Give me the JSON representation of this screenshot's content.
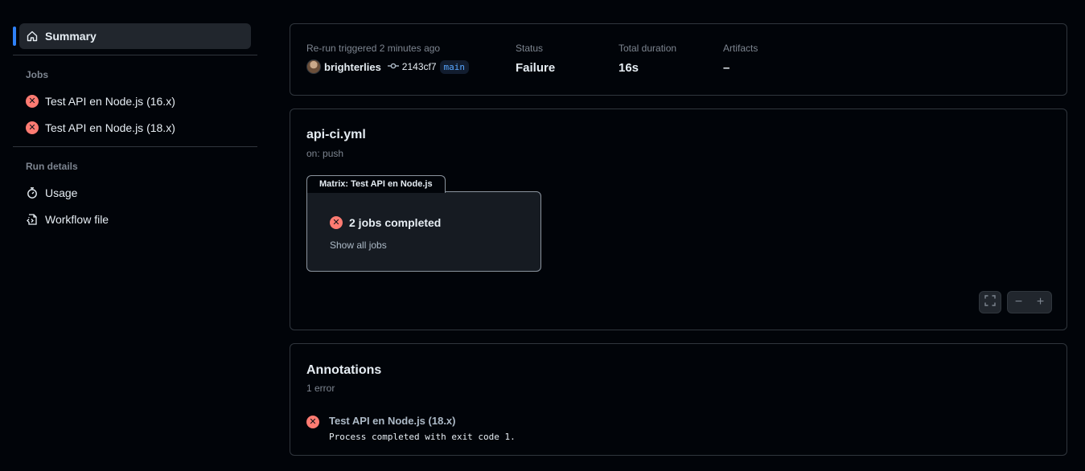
{
  "sidebar": {
    "summary_label": "Summary",
    "jobs_title": "Jobs",
    "jobs": [
      {
        "label": "Test API en Node.js (16.x)",
        "status": "failure"
      },
      {
        "label": "Test API en Node.js (18.x)",
        "status": "failure"
      }
    ],
    "run_details_title": "Run details",
    "usage_label": "Usage",
    "workflow_file_label": "Workflow file"
  },
  "summary": {
    "trigger_label": "Re-run triggered 2 minutes ago",
    "user": "brighterlies",
    "commit": "2143cf7",
    "branch": "main",
    "status_label": "Status",
    "status_value": "Failure",
    "duration_label": "Total duration",
    "duration_value": "16s",
    "artifacts_label": "Artifacts",
    "artifacts_value": "–"
  },
  "workflow": {
    "file": "api-ci.yml",
    "trigger": "on: push",
    "matrix_tab": "Matrix: Test API en Node.js",
    "matrix_status": "2 jobs completed",
    "show_all_jobs": "Show all jobs"
  },
  "annotations": {
    "title": "Annotations",
    "count_text": "1 error",
    "items": [
      {
        "job": "Test API en Node.js (18.x)",
        "message": "Process completed with exit code 1."
      }
    ]
  },
  "colors": {
    "background": "#010409",
    "failure": "#ff7b72",
    "accent": "#2f81f7",
    "branch": "#58a6ff"
  },
  "icons": [
    "home-icon",
    "x-circle-icon",
    "stopwatch-icon",
    "file-code-icon",
    "git-commit-icon",
    "screen-full-icon",
    "minus-icon",
    "plus-icon"
  ]
}
